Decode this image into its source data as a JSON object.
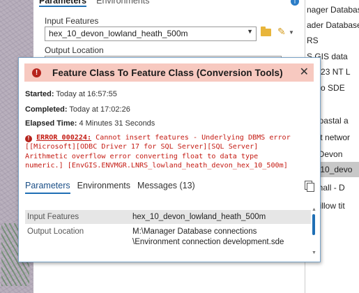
{
  "pane": {
    "tabs": [
      "Parameters",
      "Environments"
    ],
    "input_features_label": "Input Features",
    "input_features_value": "hex_10_devon_lowland_heath_500m",
    "output_location_label": "Output Location"
  },
  "catalog": {
    "items": [
      "nager Databas",
      "ader Database",
      "RS",
      "S GIS data",
      "40923 NT L",
      "ed to SDE",
      "a",
      "'s coastal a",
      "bitat networ",
      "10 Devon",
      "ex_10_devo",
      "ge hall - D",
      "n willow tit"
    ],
    "selected_index": 10
  },
  "dialog": {
    "title": "Feature Class To Feature Class (Conversion Tools)",
    "started_label": "Started:",
    "started_value": "Today at 16:57:55",
    "completed_label": "Completed:",
    "completed_value": "Today at 17:02:26",
    "elapsed_label": "Elapsed Time:",
    "elapsed_value": "4 Minutes 31 Seconds",
    "error_code": "ERROR 000224:",
    "error_line1": "Cannot insert features - Underlying DBMS error",
    "error_line2": "[[Microsoft][ODBC Driver 17 for SQL Server][SQL Server]",
    "error_line3": "Arithmetic overflow error converting float to data type",
    "error_line4": "numeric.] [EnvGIS.ENVMGR.LNRS_lowland_heath_devon_hex_10_500m]",
    "tabs": [
      "Parameters",
      "Environments",
      "Messages (13)"
    ],
    "params": [
      {
        "name": "Input Features",
        "value": "hex_10_devon_lowland_heath_500m"
      },
      {
        "name": "Output Location",
        "value": "M:\\Manager Database connections",
        "value2": "\\Environment connection development.sde"
      }
    ]
  }
}
